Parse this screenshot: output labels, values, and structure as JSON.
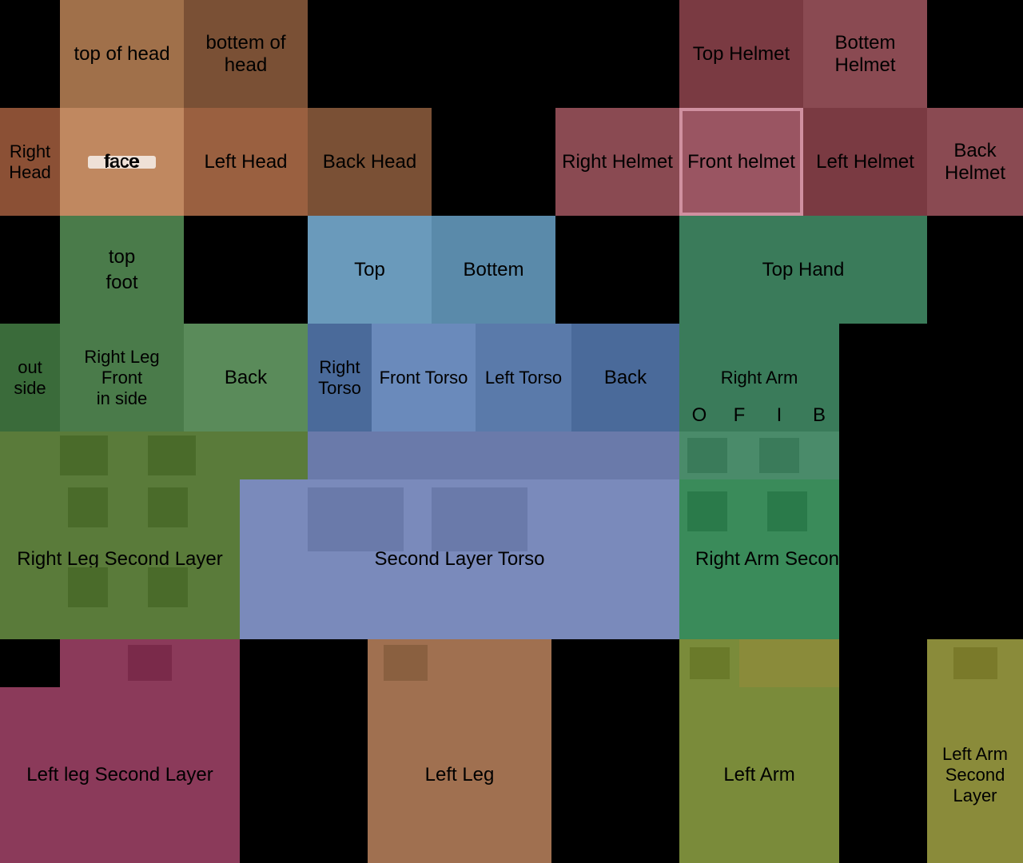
{
  "cells": {
    "top_of_head_label": "top of head",
    "bottem_of_head_label": "bottem of head",
    "top_helmet_label": "Top Helmet",
    "bottem_helmet_label": "Bottem Helmet",
    "right_head_label": "Right Head",
    "face_label": "face",
    "left_head_label": "Left Head",
    "back_head_label": "Back Head",
    "right_helmet_label": "Right Helmet",
    "front_helmet_label": "Front helmet",
    "left_helmet_label": "Left Helmet",
    "back_helmet_label": "Back Helmet",
    "top_label": "top",
    "foot_label": "foot",
    "top2_label": "Top",
    "bottem2_label": "Bottem",
    "top_hand_label": "Top Hand",
    "right_leg_label": "Right Leg",
    "front_torso_label": "Front Torso",
    "left_torso_label": "Left Torso",
    "back_torso_label": "Back",
    "right_arm_label": "Right Arm",
    "outside_label": "out side",
    "front_label": "Front",
    "inside_label": "in side",
    "back2_label": "Back",
    "right_torso_label": "Right Torso",
    "o_label": "O",
    "f_label": "F",
    "i_label": "I",
    "b_label": "B",
    "right_leg_sl_label": "Right Leg Second Layer",
    "second_layer_torso_label": "Second Layer Torso",
    "right_arm_sl_label": "Right Arm Second Layer",
    "left_leg_sl_label": "Left leg Second Layer",
    "left_leg_label": "Left Leg",
    "left_arm_label": "Left Arm",
    "left_arm_sl_label": "Left Arm Second Layer"
  }
}
